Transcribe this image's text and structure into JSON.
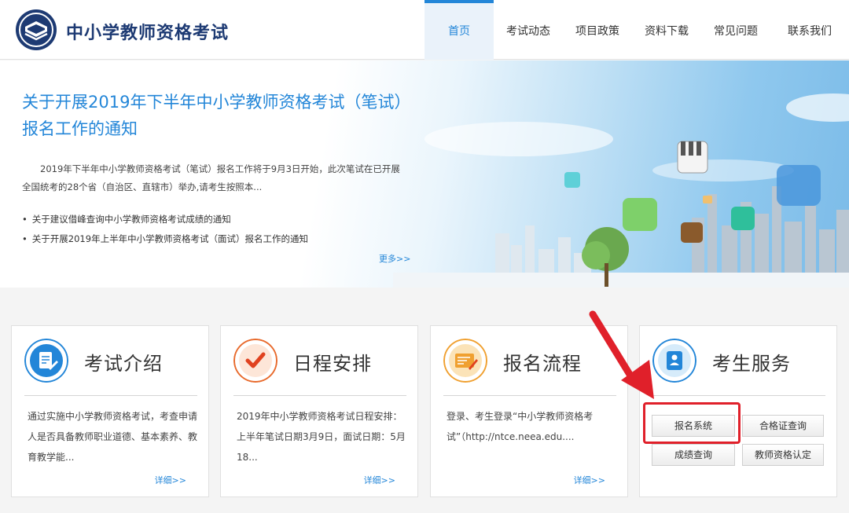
{
  "header": {
    "site_title": "中小学教师资格考试",
    "logo_icon": "book-shield-logo-icon",
    "nav": [
      {
        "label": "首页",
        "active": true
      },
      {
        "label": "考试动态",
        "active": false
      },
      {
        "label": "项目政策",
        "active": false
      },
      {
        "label": "资料下载",
        "active": false
      },
      {
        "label": "常见问题",
        "active": false
      },
      {
        "label": "联系我们",
        "active": false
      }
    ]
  },
  "banner": {
    "title": "关于开展2019年下半年中小学教师资格考试（笔试）报名工作的通知",
    "description": "2019年下半年中小学教师资格考试（笔试）报名工作将于9月3日开始，此次笔试在已开展全国统考的28个省（自治区、直辖市）举办,请考生按照本...",
    "links": [
      "关于建议借峰查询中小学教师资格考试成绩的通知",
      "关于开展2019年上半年中小学教师资格考试（面试）报名工作的通知"
    ],
    "more": "更多>>"
  },
  "cards": [
    {
      "title": "考试介绍",
      "icon": "document-edit-icon",
      "text": "通过实施中小学教师资格考试，考查申请人是否具备教师职业道德、基本素养、教育教学能...",
      "more": "详细>>"
    },
    {
      "title": "日程安排",
      "icon": "checkmark-icon",
      "text": "2019年中小学教师资格考试日程安排：上半年笔试日期3月9日，面试日期：5月18...",
      "more": "详细>>"
    },
    {
      "title": "报名流程",
      "icon": "form-pencil-icon",
      "text": "登录、考生登录“中小学教师资格考试”（http://ntce.neea.edu....",
      "more": "详细>>"
    },
    {
      "title": "考生服务",
      "icon": "contact-book-icon"
    }
  ],
  "services": [
    "报名系统",
    "合格证查询",
    "成绩查询",
    "教师资格认定"
  ],
  "colors": {
    "accent": "#2386d8",
    "highlight": "#e0202a",
    "logo": "#1d3a73"
  }
}
